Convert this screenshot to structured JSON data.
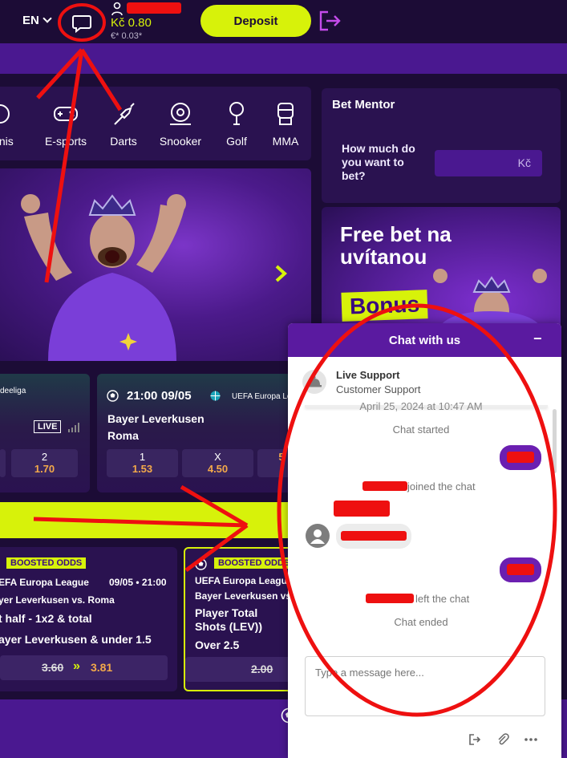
{
  "header": {
    "language": "EN",
    "balance": "Kč 0.80",
    "bonus_balance": "€* 0.03*",
    "deposit_label": "Deposit"
  },
  "sports": [
    {
      "label": "ennis",
      "icon": "tennis-icon"
    },
    {
      "label": "E-sports",
      "icon": "gamepad-icon"
    },
    {
      "label": "Darts",
      "icon": "darts-icon"
    },
    {
      "label": "Snooker",
      "icon": "snooker-icon"
    },
    {
      "label": "Golf",
      "icon": "golf-icon"
    },
    {
      "label": "MMA",
      "icon": "mma-glove-icon"
    }
  ],
  "bet_mentor": {
    "title": "Bet Mentor",
    "question": "How much do you want to bet?",
    "currency": "Kč"
  },
  "promo": {
    "title": "Free bet na uvítanou",
    "bonus": "Bonus"
  },
  "matches": [
    {
      "league": "deeliga",
      "live": "LIVE",
      "odds": [
        {
          "key": "2",
          "value": "1.70"
        }
      ]
    },
    {
      "time": "21:00",
      "date": "09/05",
      "league": "UEFA Europa Le",
      "team1": "Bayer Leverkusen",
      "team2": "Roma",
      "odds": [
        {
          "key": "1",
          "value": "1.53"
        },
        {
          "key": "X",
          "value": "4.50"
        },
        {
          "key": "",
          "value": "5"
        }
      ]
    }
  ],
  "boosted": [
    {
      "tag": "BOOSTED ODDS",
      "league": "EFA Europa League",
      "datetime": "09/05 • 21:00",
      "match": "yer Leverkusen vs. Roma",
      "market": "t half - 1x2 & total",
      "selection": "ayer Leverkusen & under 1.5",
      "old_odds": "3.60",
      "new_odds": "3.81"
    },
    {
      "tag": "BOOSTED ODDS",
      "league": "UEFA Europa League",
      "match": "Bayer Leverkusen vs",
      "market": "Player Total Shots (LEV))",
      "selection": "Over 2.5",
      "old_odds": "2.00"
    }
  ],
  "chat": {
    "title": "Chat with us",
    "minimize": "−",
    "agent_name": "Live Support",
    "agent_role": "Customer Support",
    "date": "April 25, 2024 at 10:47 AM",
    "started": "Chat started",
    "joined_suffix": "joined the chat",
    "left_suffix": "left the chat",
    "ended": "Chat ended",
    "input_placeholder": "Type a message here..."
  },
  "colors": {
    "background": "#1c0c36",
    "panel": "#2a1250",
    "accent_lime": "#d7f20a",
    "brand_purple": "#5a1aa0",
    "odds_orange": "#f3a94a",
    "annotation_red": "#ee1010"
  }
}
